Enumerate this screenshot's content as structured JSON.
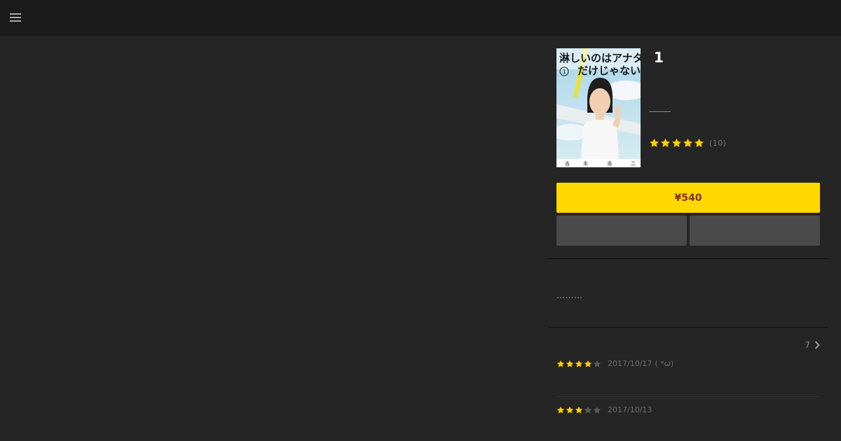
{
  "header": {
    "menu_icon": "hamburger-menu-icon"
  },
  "book": {
    "title": "1",
    "rating_value": 5,
    "rating_max": 5,
    "rating_count": "(10)",
    "price_label": "¥540",
    "description": "………"
  },
  "reviews": {
    "count": "7",
    "items": [
      {
        "stars": 4,
        "date": "2017/10/17",
        "note": "( *ω)"
      },
      {
        "stars": 3,
        "date": "2017/10/13",
        "note": ""
      }
    ]
  },
  "colors": {
    "accent": "#ffd800",
    "price_text": "#8a2d0a",
    "star_filled": "#ffd000",
    "star_empty": "#5a5a5a",
    "background": "#252525",
    "topbar": "#1b1b1b"
  }
}
